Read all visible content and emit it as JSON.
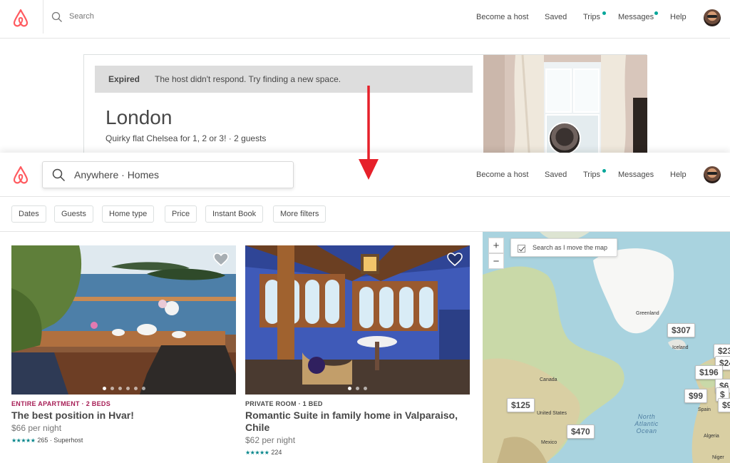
{
  "brand": {
    "color": "#ff5a5f",
    "logo_icon": "airbnb-belo-icon"
  },
  "top_screen": {
    "search_placeholder": "Search",
    "nav": {
      "become_host": "Become a host",
      "saved": "Saved",
      "trips": "Trips",
      "messages": "Messages",
      "help": "Help"
    },
    "trip": {
      "status": "Expired",
      "message": "The host didn't respond. Try finding a new space.",
      "city": "London",
      "details": "Quirky flat Chelsea for 1, 2 or 3! · 2 guests"
    }
  },
  "bottom_screen": {
    "search_value": "Anywhere · Homes",
    "nav": {
      "become_host": "Become a host",
      "saved": "Saved",
      "trips": "Trips",
      "messages": "Messages",
      "help": "Help"
    },
    "filters": [
      "Dates",
      "Guests",
      "Home type",
      "Price",
      "Instant Book",
      "More filters"
    ],
    "listings": [
      {
        "type": "ENTIRE APARTMENT · 2 BEDS",
        "type_color": "#a61d55",
        "title": "The best position in Hvar!",
        "price": "$66 per night",
        "rating_count": "265",
        "badge": "· Superhost",
        "stars": 5
      },
      {
        "type": "PRIVATE ROOM · 1 BED",
        "type_color": "#484848",
        "title": "Romantic Suite in family home in Valparaiso, Chile",
        "price": "$62 per night",
        "rating_count": "224",
        "badge": "",
        "stars": 5
      }
    ],
    "map": {
      "zoom_in": "+",
      "zoom_out": "−",
      "search_as_move": "Search as I move the map",
      "prices": [
        "$307",
        "$23",
        "$24",
        "$196",
        "$6",
        "$99",
        "$",
        "$9",
        "$125",
        "$470"
      ],
      "places": [
        "Greenland",
        "Iceland",
        "Canada",
        "United States",
        "Spain",
        "Mexico",
        "Algeria",
        "Niger"
      ],
      "ocean": "North Atlantic Ocean"
    }
  }
}
